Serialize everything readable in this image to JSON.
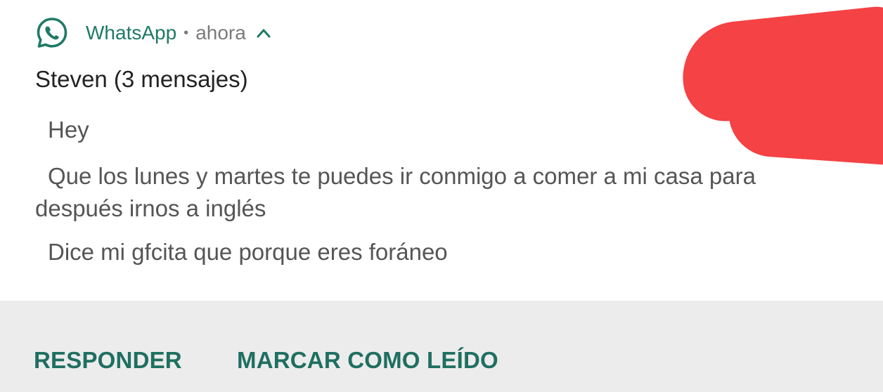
{
  "header": {
    "app_name": "WhatsApp",
    "separator": "•",
    "time": "ahora",
    "icon": "whatsapp-icon",
    "expand_icon": "chevron-up-icon"
  },
  "notification": {
    "title": "Steven (3 mensajes)",
    "messages": [
      "Hey",
      "Que los lunes y martes te puedes ir conmigo a comer a mi casa para después irnos a inglés",
      "Dice mi gfcita que porque eres foráneo"
    ]
  },
  "actions": {
    "reply_label": "RESPONDER",
    "mark_read_label": "MARCAR COMO LEÍDO"
  },
  "colors": {
    "accent": "#1f7a66",
    "action": "#1f6f61",
    "redaction": "#f44245",
    "action_bar_bg": "#ececec"
  }
}
